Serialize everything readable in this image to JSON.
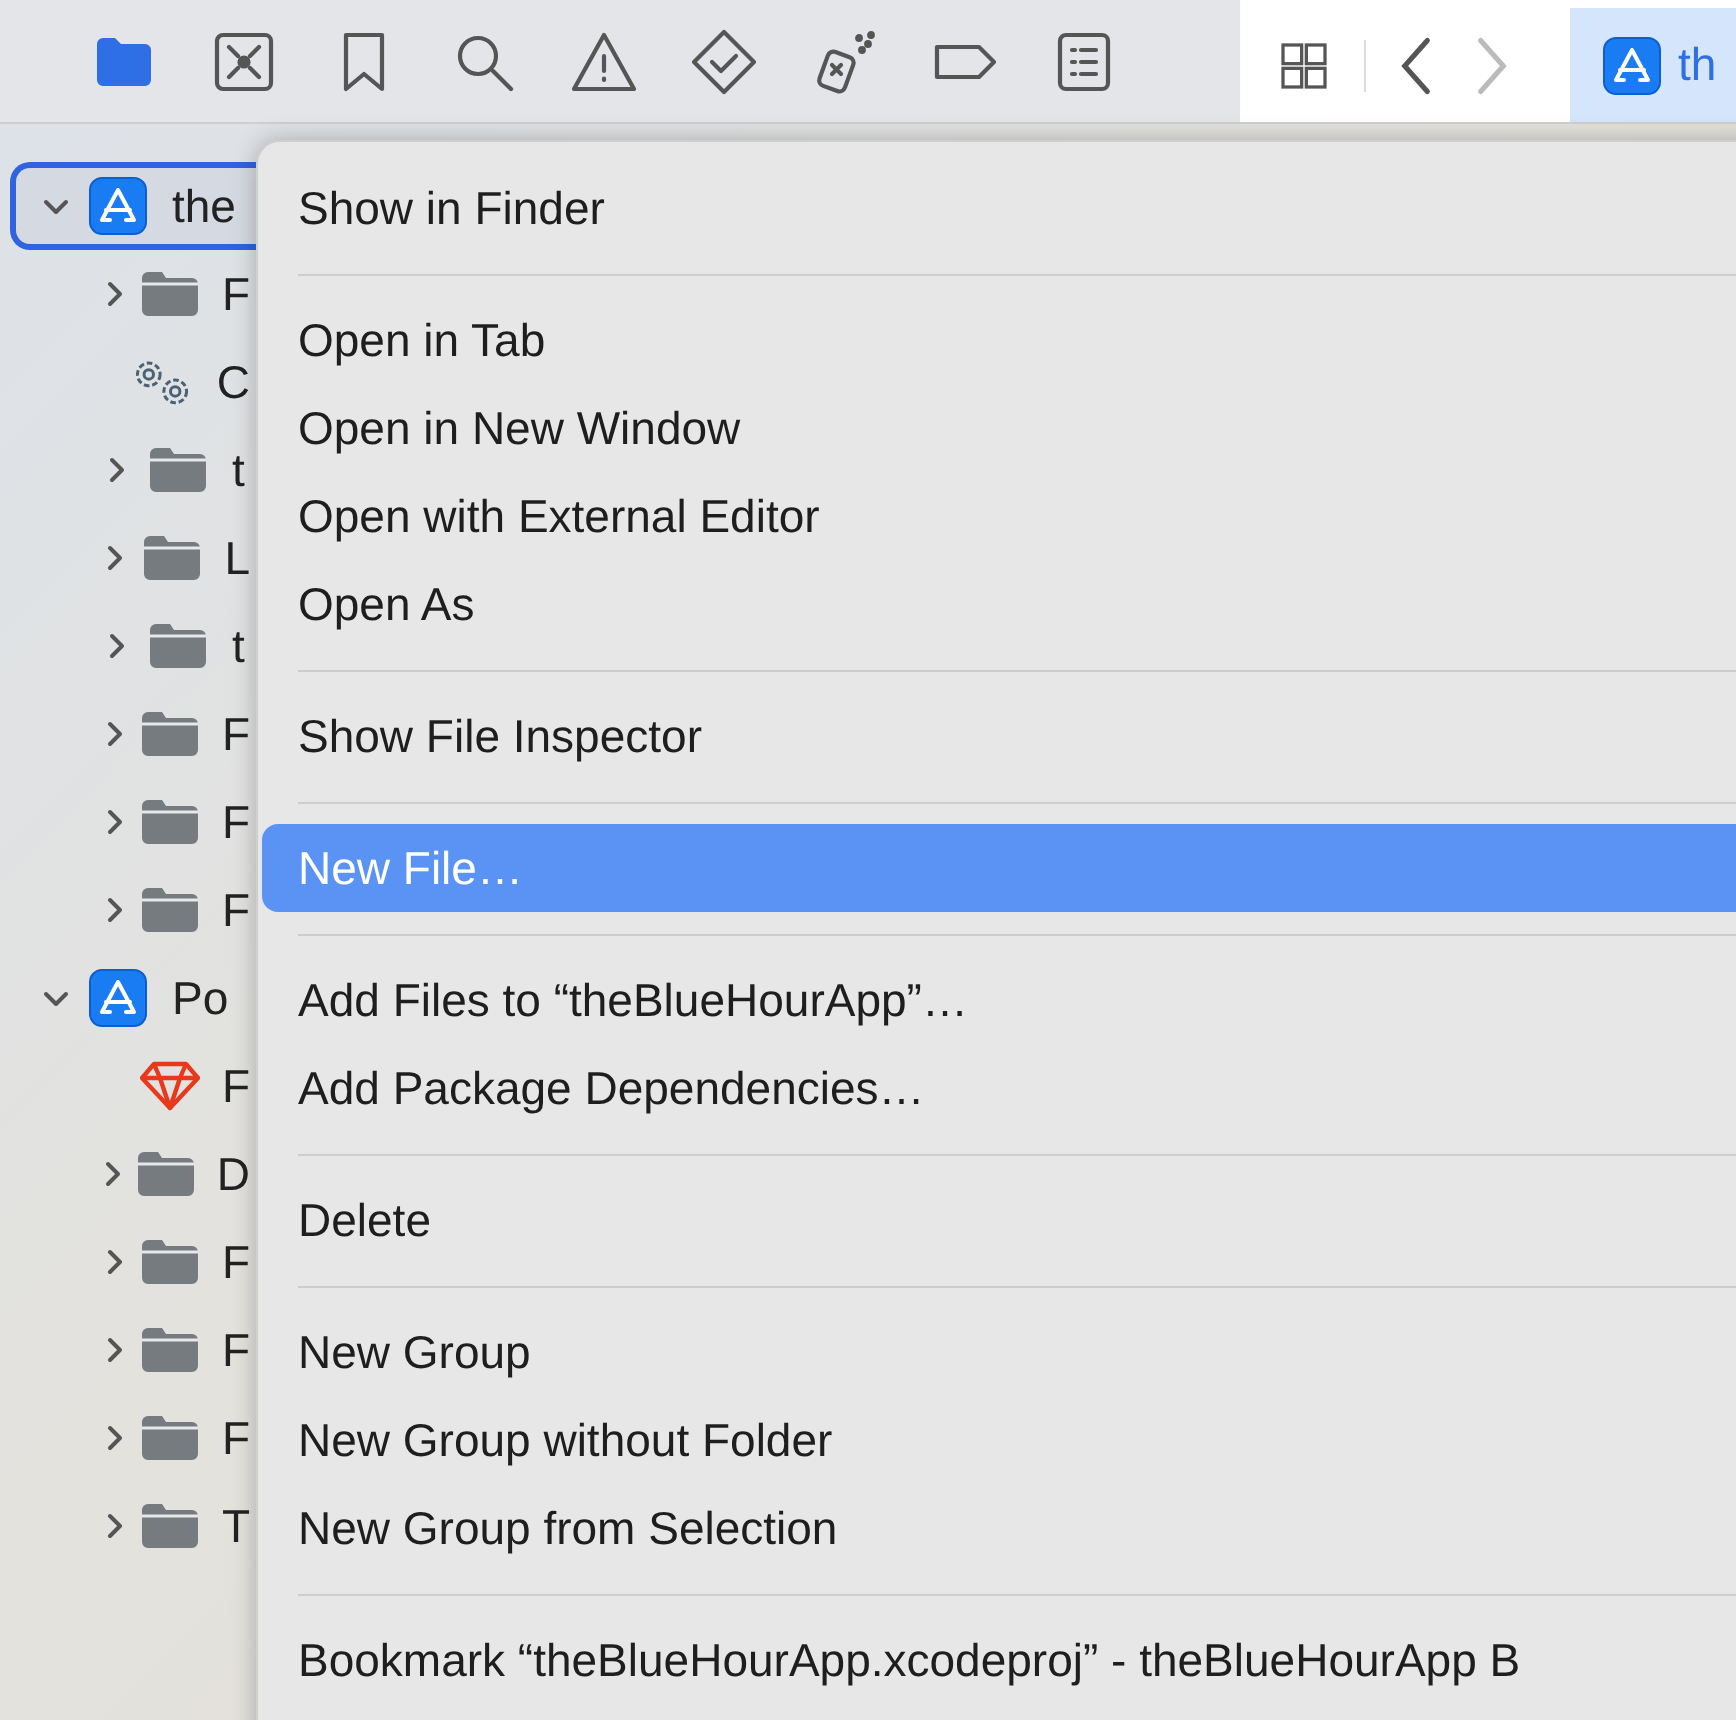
{
  "navigator_tabs": [
    {
      "selected": true
    },
    {
      "selected": false
    },
    {
      "selected": false
    },
    {
      "selected": false
    },
    {
      "selected": false
    },
    {
      "selected": false
    },
    {
      "selected": false
    },
    {
      "selected": false
    },
    {
      "selected": false
    }
  ],
  "editor": {
    "back_disabled": false,
    "forward_disabled": true,
    "tab": {
      "label": "th",
      "selected": true
    }
  },
  "tree": [
    {
      "kind": "project",
      "label": "the",
      "selected": true,
      "expanded": true,
      "children": [
        {
          "kind": "folder",
          "label": "F",
          "selected": false,
          "expanded": false
        },
        {
          "kind": "config",
          "label": "C",
          "selected": false
        },
        {
          "kind": "folder",
          "label": "t",
          "selected": false,
          "expanded": false
        },
        {
          "kind": "folder",
          "label": "L",
          "selected": false,
          "expanded": false
        },
        {
          "kind": "folder",
          "label": "t",
          "selected": false,
          "expanded": false
        },
        {
          "kind": "folder",
          "label": "F",
          "selected": false,
          "expanded": false
        },
        {
          "kind": "folder",
          "label": "F",
          "selected": false,
          "expanded": false
        },
        {
          "kind": "folder",
          "label": "F",
          "selected": false,
          "expanded": false
        }
      ]
    },
    {
      "kind": "project",
      "label": "Po",
      "selected": false,
      "expanded": true,
      "children": [
        {
          "kind": "gem",
          "label": "F",
          "selected": false
        },
        {
          "kind": "folder",
          "label": "D",
          "selected": false,
          "expanded": false
        },
        {
          "kind": "folder",
          "label": "F",
          "selected": false,
          "expanded": false
        },
        {
          "kind": "folder",
          "label": "F",
          "selected": false,
          "expanded": false
        },
        {
          "kind": "folder",
          "label": "F",
          "selected": false,
          "expanded": false
        },
        {
          "kind": "folder",
          "label": "T",
          "selected": false,
          "expanded": false
        }
      ]
    }
  ],
  "context_menu": [
    [
      {
        "label": "Show in Finder",
        "selected": false
      }
    ],
    [
      {
        "label": "Open in Tab",
        "selected": false
      },
      {
        "label": "Open in New Window",
        "selected": false
      },
      {
        "label": "Open with External Editor",
        "selected": false
      },
      {
        "label": "Open As",
        "selected": false
      }
    ],
    [
      {
        "label": "Show File Inspector",
        "selected": false
      }
    ],
    [
      {
        "label": "New File…",
        "selected": true
      }
    ],
    [
      {
        "label": "Add Files to “theBlueHourApp”…",
        "selected": false
      },
      {
        "label": "Add Package Dependencies…",
        "selected": false
      }
    ],
    [
      {
        "label": "Delete",
        "selected": false
      }
    ],
    [
      {
        "label": "New Group",
        "selected": false
      },
      {
        "label": "New Group without Folder",
        "selected": false
      },
      {
        "label": "New Group from Selection",
        "selected": false
      }
    ],
    [
      {
        "label": "Bookmark “theBlueHourApp.xcodeproj” - theBlueHourApp B",
        "selected": false
      }
    ]
  ]
}
